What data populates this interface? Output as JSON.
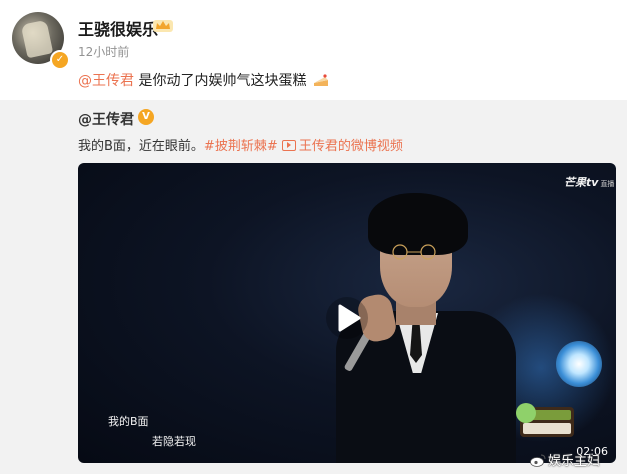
{
  "post": {
    "username": "王骁很娱乐",
    "time": "12小时前",
    "mention": "@王传君",
    "text": " 是你动了内娱帅气这块蛋糕"
  },
  "repost": {
    "author": "@王传君",
    "text_prefix": "我的B面，近在眼前。",
    "hashtag": "#披荆斩棘#",
    "video_link": "王传君的微博视频"
  },
  "video": {
    "logo": "芒果tv",
    "logo_sub": "直播",
    "caption_line1": "我的B面",
    "caption_line2": "若隐若现",
    "duration": "02:06"
  },
  "watermark": "娱乐主妇",
  "colors": {
    "link": "#eb7350",
    "verified": "#f5a623",
    "repost_bg": "#f2f2f2"
  }
}
